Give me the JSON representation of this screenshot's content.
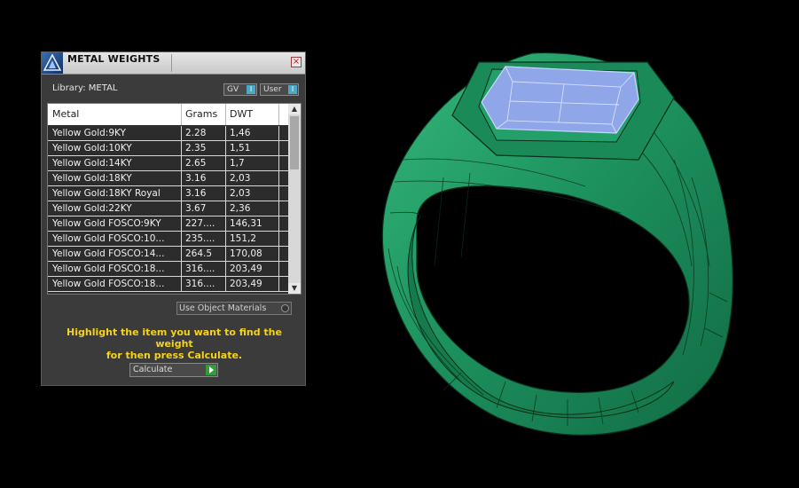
{
  "panel": {
    "title": "METAL WEIGHTS",
    "close_glyph": "×",
    "library_label": "Library: METAL",
    "toggle_gv": "GV",
    "toggle_user": "User",
    "toggle_glyph": "I",
    "columns": [
      "Metal",
      "Grams",
      "DWT"
    ],
    "rows": [
      [
        "Yellow Gold:9KY",
        "2.28",
        "1,46"
      ],
      [
        "Yellow Gold:10KY",
        "2.35",
        "1,51"
      ],
      [
        "Yellow Gold:14KY",
        "2.65",
        "1,7"
      ],
      [
        "Yellow Gold:18KY",
        "3.16",
        "2,03"
      ],
      [
        "Yellow Gold:18KY Royal",
        "3.16",
        "2,03"
      ],
      [
        "Yellow Gold:22KY",
        "3.67",
        "2,36"
      ],
      [
        "Yellow Gold FOSCO:9KY",
        "227....",
        "146,31"
      ],
      [
        "Yellow Gold FOSCO:10...",
        "235....",
        "151,2"
      ],
      [
        "Yellow Gold FOSCO:14...",
        "264.5",
        "170,08"
      ],
      [
        "Yellow Gold FOSCO:18...",
        "316....",
        "203,49"
      ],
      [
        "Yellow Gold FOSCO:18...",
        "316....",
        "203,49"
      ]
    ],
    "use_object_materials": "Use Object Materials",
    "hint_line1": "Highlight the item you want to find the weight",
    "hint_line2": "for then press Calculate.",
    "calculate_label": "Calculate"
  },
  "colors": {
    "wireframe": "#1f9e66",
    "wire_lines": "#0b2e1e",
    "stone": "#8fa6e8",
    "hint_text": "#f5d21b"
  }
}
